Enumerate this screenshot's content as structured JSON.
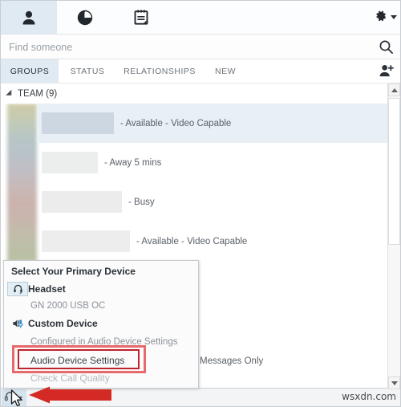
{
  "app": {
    "watermark": "wsxdn.com"
  },
  "toolbar": {
    "items": [
      {
        "name": "contacts-icon",
        "label": "Contacts",
        "active": true
      },
      {
        "name": "recent-icon",
        "label": "Recent",
        "active": false
      },
      {
        "name": "notes-icon",
        "label": "Notes",
        "active": false
      }
    ],
    "settings_label": "Settings",
    "settings_icon": "gear-icon"
  },
  "search": {
    "placeholder": "Find someone",
    "value": "",
    "icon": "search-icon"
  },
  "tabs": [
    {
      "label": "GROUPS",
      "active": true
    },
    {
      "label": "STATUS",
      "active": false
    },
    {
      "label": "RELATIONSHIPS",
      "active": false
    },
    {
      "label": "NEW",
      "active": false
    }
  ],
  "add_contact_label": "Add a contact",
  "group": {
    "label": "TEAM (9)",
    "expanded": true
  },
  "contacts": [
    {
      "name": "",
      "status": "- Available - Video Capable",
      "selected": true
    },
    {
      "name": "",
      "status": "- Away 5 mins",
      "selected": false
    },
    {
      "name": "",
      "status": "- Busy",
      "selected": false
    },
    {
      "name": "",
      "status": "- Available - Video Capable",
      "selected": false
    }
  ],
  "partial_status": "Messages Only",
  "popup": {
    "title": "Select Your Primary Device",
    "items": [
      {
        "kind": "device",
        "label": "Headset",
        "icon": "headset-icon",
        "selected": true
      },
      {
        "kind": "sub",
        "label": "GN 2000 USB OC"
      },
      {
        "kind": "device",
        "label": "Custom Device",
        "icon": "speaker-mic-icon",
        "selected": false
      },
      {
        "kind": "sub2",
        "label": "Configured in Audio Device Settings"
      },
      {
        "kind": "action",
        "label": "Audio Device Settings",
        "highlighted": true
      },
      {
        "kind": "disabled",
        "label": "Check Call Quality"
      }
    ]
  },
  "statusbar": {
    "device_button_label": "Primary device",
    "device_icon": "headset-icon",
    "caret": "chevron-down-icon"
  },
  "scrollbar": {
    "up_label": "Scroll up",
    "down_label": "Scroll down",
    "thumb_label": "Scroll thumb"
  },
  "annotation": {
    "highlight_color": "#c0232b",
    "halo_color": "#e8696b",
    "arrow_color": "#d42a24"
  }
}
